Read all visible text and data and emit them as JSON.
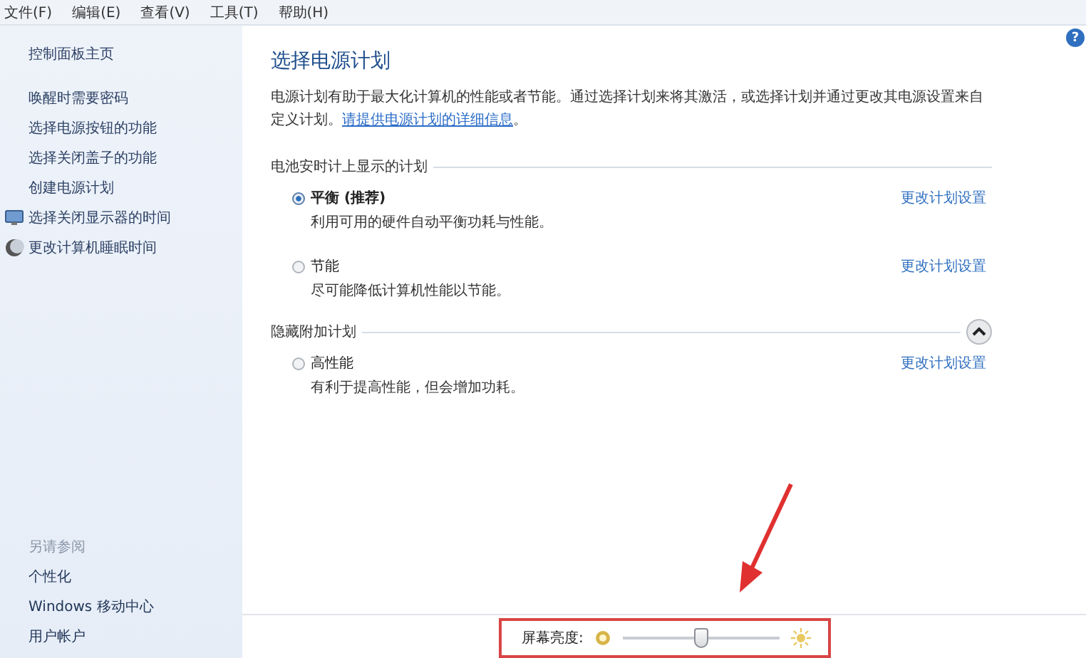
{
  "menu_bar": [
    "文件(F)",
    "编辑(E)",
    "查看(V)",
    "工具(T)",
    "帮助(H)"
  ],
  "help_button": "?",
  "sidebar": {
    "home_link": "控制面板主页",
    "tasks": [
      {
        "label": "唤醒时需要密码",
        "kind": "plain"
      },
      {
        "label": "选择电源按钮的功能",
        "kind": "plain"
      },
      {
        "label": "选择关闭盖子的功能",
        "kind": "plain"
      },
      {
        "label": "创建电源计划",
        "kind": "plain"
      },
      {
        "label": "选择关闭显示器的时间",
        "kind": "display"
      },
      {
        "label": "更改计算机睡眠时间",
        "kind": "sleep"
      }
    ],
    "see_also": {
      "heading": "另请参阅",
      "links": [
        "个性化",
        "Windows 移动中心",
        "用户帐户"
      ]
    }
  },
  "main": {
    "title": "选择电源计划",
    "description": {
      "text": "电源计划有助于最大化计算机的性能或者节能。通过选择计划来将其激活，或选择计划并通过更改其电源设置来自定义计划。",
      "link": "请提供电源计划的详细信息",
      "suffix": "。"
    },
    "sections": [
      {
        "heading": "电池安时计上显示的计划",
        "kind": "fixed",
        "plans": [
          {
            "name": "平衡 (推荐)",
            "selected": true,
            "description": "利用可用的硬件自动平衡功耗与性能。",
            "settings_link": "更改计划设置"
          },
          {
            "name": "节能",
            "selected": false,
            "description": "尽可能降低计算机性能以节能。",
            "settings_link": "更改计划设置"
          }
        ]
      },
      {
        "heading": "隐藏附加计划",
        "kind": "collapsible",
        "expanded": true,
        "plans": [
          {
            "name": "高性能",
            "selected": false,
            "description": "有利于提高性能，但会增加功耗。",
            "settings_link": "更改计划设置"
          }
        ]
      }
    ]
  },
  "brightness": {
    "label": "屏幕亮度:",
    "level": 0.5,
    "highlighted": true
  }
}
